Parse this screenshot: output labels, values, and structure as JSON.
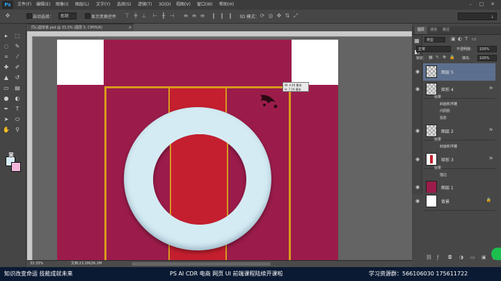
{
  "app": {
    "logo": "Ps"
  },
  "menubar": {
    "items": [
      "文件(F)",
      "编辑(E)",
      "图像(I)",
      "图层(L)",
      "文字(Y)",
      "选择(S)",
      "滤镜(T)",
      "3D(D)",
      "视图(V)",
      "窗口(W)",
      "帮助(H)"
    ],
    "window_controls": {
      "min": "–",
      "max": "□",
      "close": "✕"
    }
  },
  "options": {
    "auto_select_label": "自动选择：",
    "auto_select_value": "形状",
    "show_transform_label": "显示变换控件",
    "mode_label": "3D 模式：",
    "workspace_value": "↓"
  },
  "document": {
    "tab_title": "同心圆背景.psd @ 33.3% (图层 5, CMYK/8)",
    "tab_close": "×",
    "zoom": "33.33%",
    "doc_size": "文档:23.2M/26.2M",
    "tooltip_w": "W: 4.40 厘米",
    "tooltip_h": "H: 7.16 厘米"
  },
  "panels": {
    "tabs": [
      "图层",
      "通道",
      "路径"
    ],
    "filter_kind": "类型",
    "blend_mode": "正常",
    "opacity_label": "不透明度:",
    "opacity_value": "100%",
    "lock_label": "锁定:",
    "fill_label": "填充:",
    "fill_value": "100%"
  },
  "layers": [
    {
      "name": "图层 5",
      "selected": true,
      "thumb": "checker",
      "fx": ""
    },
    {
      "name": "矩形 4",
      "selected": false,
      "thumb": "checker",
      "fx": "fx"
    },
    {
      "name": "图层 2",
      "selected": false,
      "thumb": "checker",
      "fx": "fx"
    },
    {
      "name": "矩形 3",
      "selected": false,
      "thumb": "red-strip",
      "fx": "fx"
    },
    {
      "name": "图层 1",
      "selected": false,
      "thumb": "crimson",
      "fx": ""
    },
    {
      "name": "背景",
      "selected": false,
      "thumb": "white",
      "fx": ""
    }
  ],
  "effects": {
    "rect4": [
      "效果",
      "斜面和浮雕",
      "内阴影",
      "投影"
    ],
    "layer2": [
      "效果",
      "斜面和浮雕"
    ],
    "rect3": [
      "效果",
      "描边"
    ]
  },
  "footer": {
    "left": "知识改变命运 技能成就未来",
    "center": "PS  AI CDR 电商  网页 UI 前端课程陆续开课啦",
    "right": "学习资源群：566106030  175611722"
  },
  "colors": {
    "canvas_bg": "#9b1c4a",
    "strip": "#c41f2f",
    "ring": "#d5ebf3",
    "border_gold": "#d79a1e",
    "selection": "#5d6f8e",
    "footer_bg": "#0b1a33"
  }
}
